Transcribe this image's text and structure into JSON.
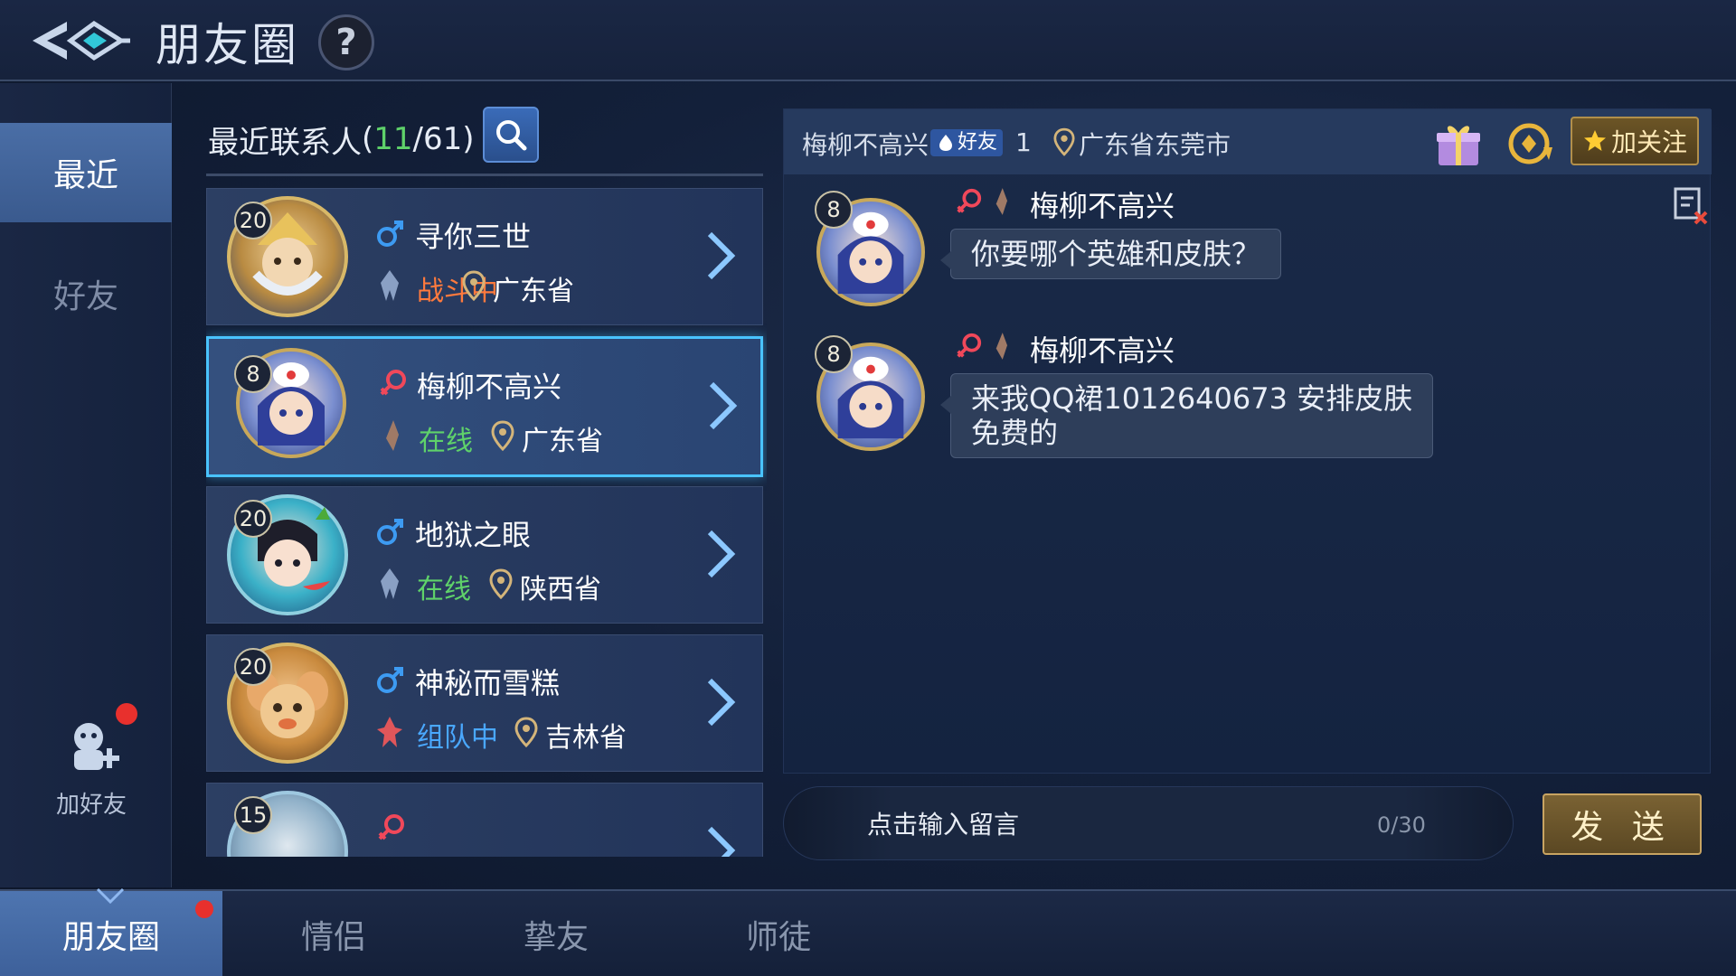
{
  "header": {
    "title": "朋友圈",
    "help": "?"
  },
  "leftnav": {
    "items": [
      "最近",
      "好友"
    ],
    "add_friend": "加好友"
  },
  "contacts": {
    "header_label": "最近联系人",
    "online_count": "11",
    "total_count": "61",
    "items": [
      {
        "level": "20",
        "name": "寻你三世",
        "gender": "male",
        "status": "战斗中",
        "status_color": "#ff7a3d",
        "region": "广东省"
      },
      {
        "level": "8",
        "name": "梅柳不高兴",
        "gender": "female",
        "status": "在线",
        "status_color": "#5fd26a",
        "region": "广东省",
        "selected": true
      },
      {
        "level": "20",
        "name": "地狱之眼",
        "gender": "male",
        "status": "在线",
        "status_color": "#5fd26a",
        "region": "陕西省"
      },
      {
        "level": "20",
        "name": "神秘而雪糕",
        "gender": "male",
        "status": "组队中",
        "status_color": "#4aa8ff",
        "region": "吉林省"
      },
      {
        "level": "15",
        "name": "",
        "gender": "female",
        "status": "",
        "region": ""
      }
    ]
  },
  "chat": {
    "name": "梅柳不高兴",
    "badge": "好友",
    "intimacy": "1",
    "location": "广东省东莞市",
    "follow_label": "加关注",
    "messages": [
      {
        "level": "8",
        "sender": "梅柳不高兴",
        "text": "你要哪个英雄和皮肤？"
      },
      {
        "level": "8",
        "sender": "梅柳不高兴",
        "line1": "来我QQ裙1012640673 安排皮肤",
        "line2": "免费的"
      }
    ]
  },
  "input": {
    "placeholder": "点击输入留言",
    "counter": "0/30",
    "send_label": "发 送"
  },
  "bottom_tabs": [
    "朋友圈",
    "情侣",
    "挚友",
    "师徒"
  ],
  "colors": {
    "accent_blue": "#49c3ff",
    "online_green": "#5fd26a",
    "battle_orange": "#ff7a3d",
    "team_blue": "#4aa8ff",
    "gold": "#c8a462"
  }
}
